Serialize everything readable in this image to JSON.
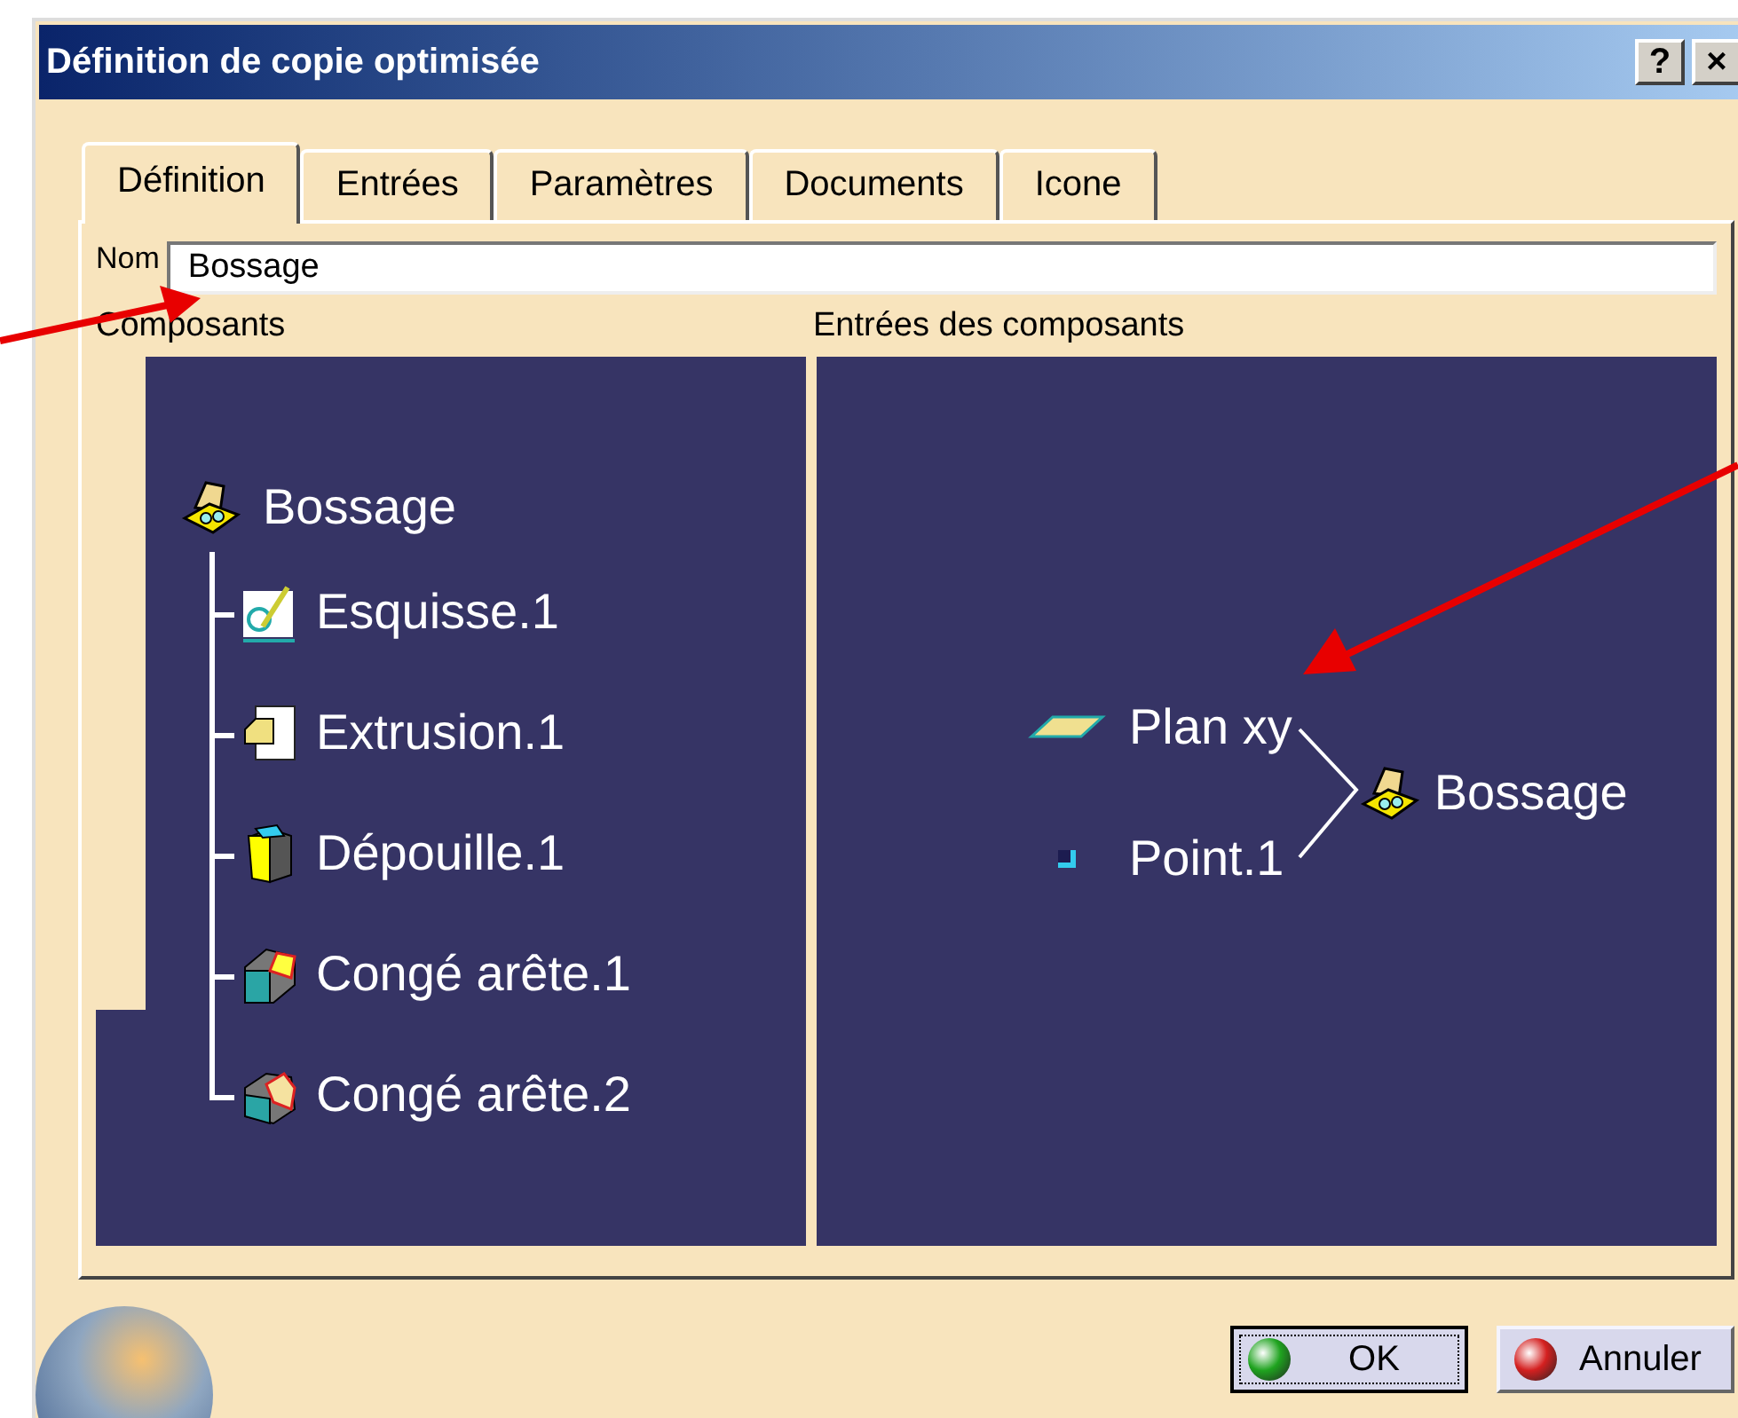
{
  "window": {
    "title": "Définition de copie optimisée",
    "controls": [
      "?",
      "×"
    ]
  },
  "tabs": [
    {
      "label": "Définition",
      "selected": true
    },
    {
      "label": "Entrées",
      "selected": false
    },
    {
      "label": "Paramètres",
      "selected": false
    },
    {
      "label": "Documents",
      "selected": false
    },
    {
      "label": "Icone",
      "selected": false
    }
  ],
  "name_field": {
    "label": "Nom",
    "value": "Bossage"
  },
  "components": {
    "label": "Composants",
    "tree": {
      "label": "Bossage",
      "kind": "body",
      "children": [
        {
          "label": "Esquisse.1",
          "kind": "sketch"
        },
        {
          "label": "Extrusion.1",
          "kind": "pad"
        },
        {
          "label": "Dépouille.1",
          "kind": "draft"
        },
        {
          "label": "Congé arête.1",
          "kind": "fillet"
        },
        {
          "label": "Congé arête.2",
          "kind": "fillet2"
        }
      ]
    }
  },
  "component_inputs": {
    "label": "Entrées des composants",
    "inputs": [
      {
        "label": "Plan xy",
        "kind": "plane"
      },
      {
        "label": "Point.1",
        "kind": "point"
      }
    ],
    "target": {
      "label": "Bossage",
      "kind": "body"
    }
  },
  "buttons": [
    {
      "label": "OK",
      "kind": "ok",
      "focused": true
    },
    {
      "label": "Annuler",
      "kind": "cancel",
      "focused": false
    }
  ]
}
